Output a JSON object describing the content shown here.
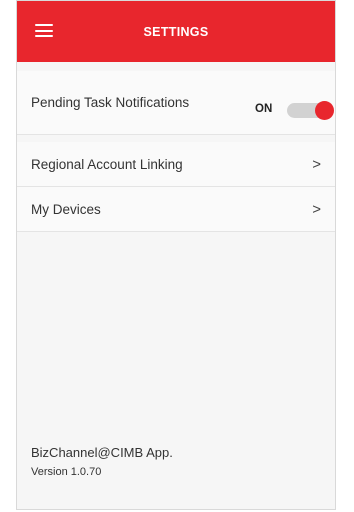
{
  "header": {
    "title": "SETTINGS",
    "menu_icon": "hamburger-menu-icon"
  },
  "settings": {
    "notifications": {
      "label": "Pending Task Notifications",
      "state_label": "ON",
      "enabled": true
    },
    "items": [
      {
        "label": "Regional Account Linking",
        "chevron": ">"
      },
      {
        "label": "My Devices",
        "chevron": ">"
      }
    ]
  },
  "footer": {
    "app_name": "BizChannel@CIMB App.",
    "version": "Version 1.0.70"
  },
  "colors": {
    "accent": "#e8262d",
    "background": "#f6f6f6",
    "toggle_track": "#d2d2d2"
  }
}
